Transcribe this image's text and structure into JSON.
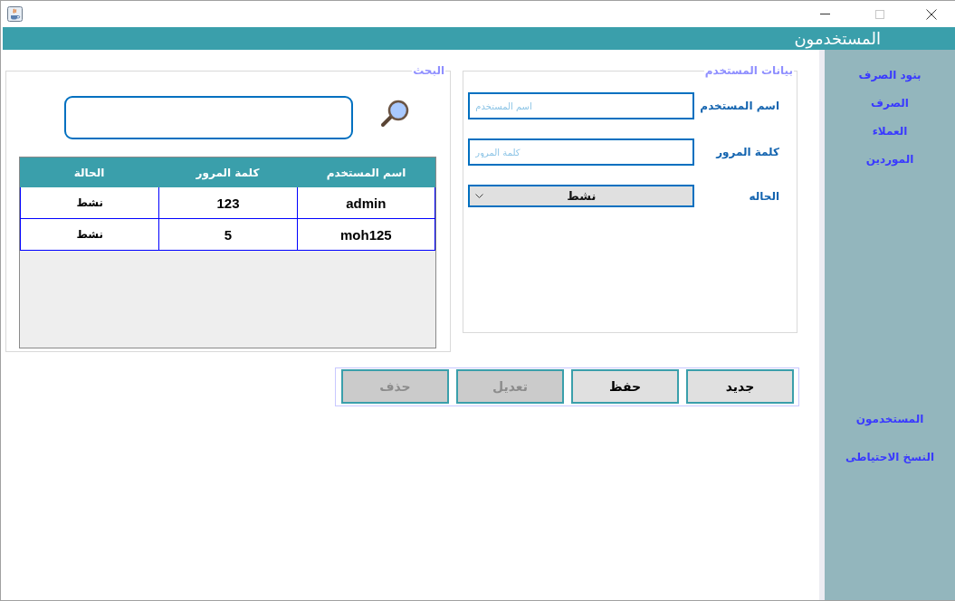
{
  "header": {
    "title": "المستخدمون"
  },
  "user_form": {
    "title": "بيانات المستخدم",
    "fields": [
      {
        "kind": "text",
        "label": "اسم المستخدم",
        "placeholder": "اسم المستخدم"
      },
      {
        "kind": "text",
        "label": "كلمة المرور",
        "placeholder": "كلمة المرور"
      },
      {
        "kind": "select",
        "label": "الحاله",
        "value": "نشط"
      }
    ]
  },
  "search_panel": {
    "title": "البحث",
    "table": {
      "columns": [
        "اسم المستخدم",
        "كلمة المرور",
        "الحالة"
      ],
      "rows": [
        [
          "admin",
          "123",
          "نشط"
        ],
        [
          "moh125",
          "5",
          "نشط"
        ]
      ]
    }
  },
  "actions": [
    {
      "label": "جديد",
      "disabled": false
    },
    {
      "label": "حفظ",
      "disabled": false
    },
    {
      "label": "تعديل",
      "disabled": true
    },
    {
      "label": "حذف",
      "disabled": true
    }
  ],
  "sidebar": {
    "items": [
      {
        "label": "بنود الصرف"
      },
      {
        "label": "الصرف"
      },
      {
        "label": "العملاء"
      },
      {
        "label": "الموردين"
      }
    ],
    "bottom_items": [
      {
        "label": "المستخدمون"
      },
      {
        "label": "النسخ الاحتياطى"
      }
    ]
  }
}
